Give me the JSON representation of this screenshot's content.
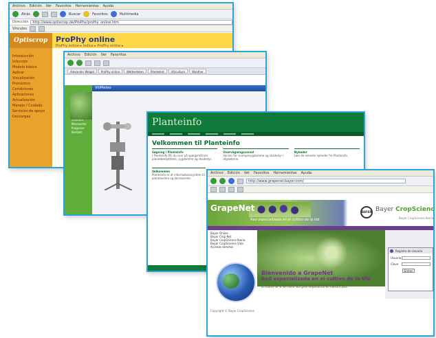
{
  "browser": {
    "menu_items": [
      "Archivo",
      "Edición",
      "Ver",
      "Favoritos",
      "Herramientas",
      "Ayuda"
    ],
    "toolbar_labels": [
      "Atrás",
      "Buscar",
      "Favoritos",
      "Multimedia"
    ],
    "address_label": "Dirección",
    "links_label": "Vínculos"
  },
  "window1": {
    "address": "http://www.optiscrop.de/ProPhy/profhy_online.htm",
    "logo": "Optiscrop",
    "title": "ProPhy online",
    "breadcrumb": "ProPhy online ▸ Índice ▸ ProPhy online ▸",
    "sidebar_items": [
      "Introducción",
      "Infección",
      "Modelo básico",
      "Aplicar",
      "Visualización",
      "Pronóstico",
      "Condiciones",
      "Aplicaciones",
      "Actualización",
      "Manejo / Cuidado",
      "Servicios de apoyo",
      "Descargas"
    ]
  },
  "window2": {
    "tabs": [
      "Alexander Weigel",
      "ProPhy online",
      "Wetterdaten",
      "Plantetrot",
      "Viticulture",
      "Weather"
    ],
    "inner_title": "VitiMeteo",
    "side_items": [
      "Start",
      "Aufbau",
      "Funktion",
      "Messwerte",
      "Prognose",
      "Kontakt"
    ]
  },
  "window3": {
    "logo": "Planteinfo",
    "welcome": "Velkommen til Planteinfo",
    "columns": [
      {
        "heading": "Søgning i Planteinfo",
        "text": "I Planteinfo får du svar på spørgsmål om plantebeskyttelse, sygdomme og skadedyr."
      },
      {
        "heading": "Overvågningsvarsel",
        "text": "Varsler for svampesygdomme og skadedyr i afgrøderne."
      },
      {
        "heading": "Nyheder",
        "text": "Læs de seneste nyheder fra Planteinfo."
      }
    ],
    "section": "Velkommen",
    "section_text": "Planteinfo er et informationssystem til planteavlere og konsulenter."
  },
  "window4": {
    "address": "http://www.grapenet.bayer.com/",
    "brand": "GrapeNet",
    "tagline": "Red especializada en el cultivo de la vid",
    "bayer_word": "Bayer",
    "bayer_green": "CropScience",
    "bayer_sub": "Bayer CropScience Iberia",
    "side_items": [
      "Bayer Online",
      "Bayer Crop Net",
      "Bayer CropScience Iberia",
      "Bayer CropScience Vida",
      "Accesos directos"
    ],
    "welcome_title": "Bienvenido a GrapeNet",
    "welcome_sub": "Red especializada en el cultivo de la Vid",
    "welcome_text": "El cultivo de la vid tiene una gran importancia en nuestro país.",
    "login_title": "Registro de Usuario",
    "login_user": "Usuario",
    "login_pass": "Clave",
    "login_button": "Entrar",
    "footer": "Copyright © Bayer CropScience"
  },
  "colors": {
    "frame": "#2aa3d8",
    "accent_green": "#0f7a3a",
    "accent_purple": "#7a2e8f"
  }
}
